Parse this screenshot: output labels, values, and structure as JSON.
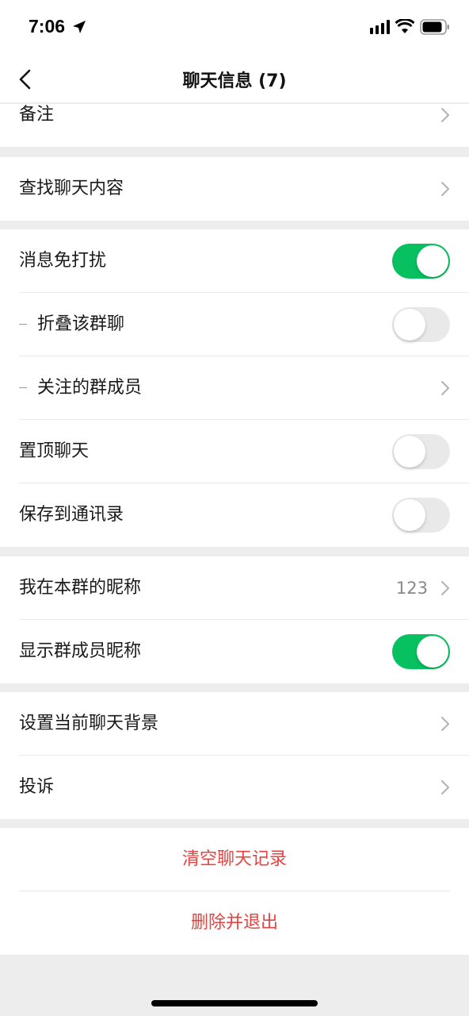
{
  "status_bar": {
    "time": "7:06"
  },
  "nav": {
    "title": "聊天信息 (7)"
  },
  "group0": {
    "remark_label": "备注"
  },
  "group1": {
    "search_label": "查找聊天内容"
  },
  "group2": {
    "mute_label": "消息免打扰",
    "mute_on": true,
    "fold_label": "折叠该群聊",
    "fold_on": false,
    "followed_label": "关注的群成员",
    "pin_label": "置顶聊天",
    "pin_on": false,
    "save_label": "保存到通讯录",
    "save_on": false
  },
  "group3": {
    "nickname_label": "我在本群的昵称",
    "nickname_value": "123",
    "show_names_label": "显示群成员昵称",
    "show_names_on": true
  },
  "group4": {
    "background_label": "设置当前聊天背景",
    "complain_label": "投诉"
  },
  "actions": {
    "clear_label": "清空聊天记录",
    "delete_label": "删除并退出"
  },
  "colors": {
    "accent_green": "#07c160",
    "danger_red": "#e64340"
  }
}
